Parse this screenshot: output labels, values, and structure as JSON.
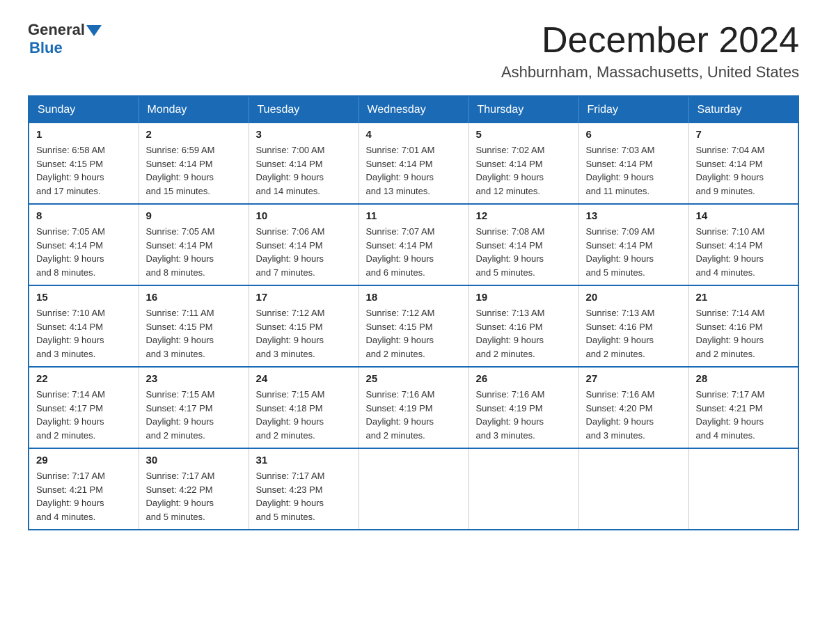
{
  "header": {
    "logo_general": "General",
    "logo_blue": "Blue",
    "month_year": "December 2024",
    "location": "Ashburnham, Massachusetts, United States"
  },
  "weekdays": [
    "Sunday",
    "Monday",
    "Tuesday",
    "Wednesday",
    "Thursday",
    "Friday",
    "Saturday"
  ],
  "weeks": [
    [
      {
        "day": "1",
        "sunrise": "6:58 AM",
        "sunset": "4:15 PM",
        "daylight": "9 hours and 17 minutes."
      },
      {
        "day": "2",
        "sunrise": "6:59 AM",
        "sunset": "4:14 PM",
        "daylight": "9 hours and 15 minutes."
      },
      {
        "day": "3",
        "sunrise": "7:00 AM",
        "sunset": "4:14 PM",
        "daylight": "9 hours and 14 minutes."
      },
      {
        "day": "4",
        "sunrise": "7:01 AM",
        "sunset": "4:14 PM",
        "daylight": "9 hours and 13 minutes."
      },
      {
        "day": "5",
        "sunrise": "7:02 AM",
        "sunset": "4:14 PM",
        "daylight": "9 hours and 12 minutes."
      },
      {
        "day": "6",
        "sunrise": "7:03 AM",
        "sunset": "4:14 PM",
        "daylight": "9 hours and 11 minutes."
      },
      {
        "day": "7",
        "sunrise": "7:04 AM",
        "sunset": "4:14 PM",
        "daylight": "9 hours and 9 minutes."
      }
    ],
    [
      {
        "day": "8",
        "sunrise": "7:05 AM",
        "sunset": "4:14 PM",
        "daylight": "9 hours and 8 minutes."
      },
      {
        "day": "9",
        "sunrise": "7:05 AM",
        "sunset": "4:14 PM",
        "daylight": "9 hours and 8 minutes."
      },
      {
        "day": "10",
        "sunrise": "7:06 AM",
        "sunset": "4:14 PM",
        "daylight": "9 hours and 7 minutes."
      },
      {
        "day": "11",
        "sunrise": "7:07 AM",
        "sunset": "4:14 PM",
        "daylight": "9 hours and 6 minutes."
      },
      {
        "day": "12",
        "sunrise": "7:08 AM",
        "sunset": "4:14 PM",
        "daylight": "9 hours and 5 minutes."
      },
      {
        "day": "13",
        "sunrise": "7:09 AM",
        "sunset": "4:14 PM",
        "daylight": "9 hours and 5 minutes."
      },
      {
        "day": "14",
        "sunrise": "7:10 AM",
        "sunset": "4:14 PM",
        "daylight": "9 hours and 4 minutes."
      }
    ],
    [
      {
        "day": "15",
        "sunrise": "7:10 AM",
        "sunset": "4:14 PM",
        "daylight": "9 hours and 3 minutes."
      },
      {
        "day": "16",
        "sunrise": "7:11 AM",
        "sunset": "4:15 PM",
        "daylight": "9 hours and 3 minutes."
      },
      {
        "day": "17",
        "sunrise": "7:12 AM",
        "sunset": "4:15 PM",
        "daylight": "9 hours and 3 minutes."
      },
      {
        "day": "18",
        "sunrise": "7:12 AM",
        "sunset": "4:15 PM",
        "daylight": "9 hours and 2 minutes."
      },
      {
        "day": "19",
        "sunrise": "7:13 AM",
        "sunset": "4:16 PM",
        "daylight": "9 hours and 2 minutes."
      },
      {
        "day": "20",
        "sunrise": "7:13 AM",
        "sunset": "4:16 PM",
        "daylight": "9 hours and 2 minutes."
      },
      {
        "day": "21",
        "sunrise": "7:14 AM",
        "sunset": "4:16 PM",
        "daylight": "9 hours and 2 minutes."
      }
    ],
    [
      {
        "day": "22",
        "sunrise": "7:14 AM",
        "sunset": "4:17 PM",
        "daylight": "9 hours and 2 minutes."
      },
      {
        "day": "23",
        "sunrise": "7:15 AM",
        "sunset": "4:17 PM",
        "daylight": "9 hours and 2 minutes."
      },
      {
        "day": "24",
        "sunrise": "7:15 AM",
        "sunset": "4:18 PM",
        "daylight": "9 hours and 2 minutes."
      },
      {
        "day": "25",
        "sunrise": "7:16 AM",
        "sunset": "4:19 PM",
        "daylight": "9 hours and 2 minutes."
      },
      {
        "day": "26",
        "sunrise": "7:16 AM",
        "sunset": "4:19 PM",
        "daylight": "9 hours and 3 minutes."
      },
      {
        "day": "27",
        "sunrise": "7:16 AM",
        "sunset": "4:20 PM",
        "daylight": "9 hours and 3 minutes."
      },
      {
        "day": "28",
        "sunrise": "7:17 AM",
        "sunset": "4:21 PM",
        "daylight": "9 hours and 4 minutes."
      }
    ],
    [
      {
        "day": "29",
        "sunrise": "7:17 AM",
        "sunset": "4:21 PM",
        "daylight": "9 hours and 4 minutes."
      },
      {
        "day": "30",
        "sunrise": "7:17 AM",
        "sunset": "4:22 PM",
        "daylight": "9 hours and 5 minutes."
      },
      {
        "day": "31",
        "sunrise": "7:17 AM",
        "sunset": "4:23 PM",
        "daylight": "9 hours and 5 minutes."
      },
      null,
      null,
      null,
      null
    ]
  ],
  "labels": {
    "sunrise": "Sunrise:",
    "sunset": "Sunset:",
    "daylight": "Daylight:"
  }
}
